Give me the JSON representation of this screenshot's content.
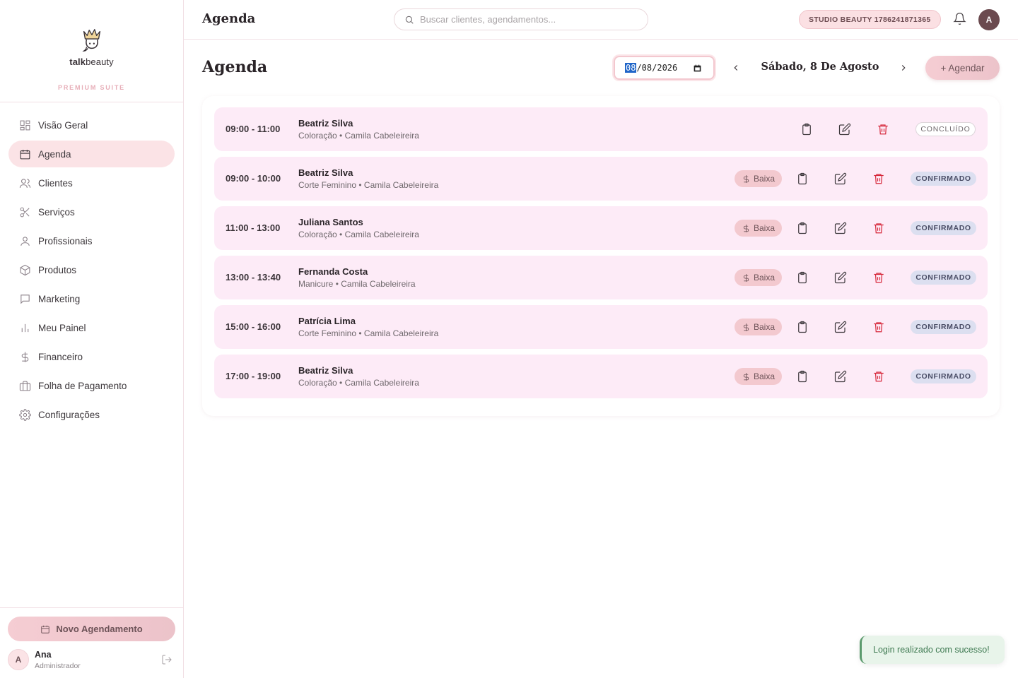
{
  "brand": {
    "name_bold": "talk",
    "name_regular": "beauty",
    "tagline": "PREMIUM SUITE"
  },
  "sidebar": {
    "items": [
      {
        "label": "Visão Geral",
        "icon": "grid-icon"
      },
      {
        "label": "Agenda",
        "icon": "calendar-icon",
        "active": true
      },
      {
        "label": "Clientes",
        "icon": "users-icon"
      },
      {
        "label": "Serviços",
        "icon": "scissors-icon"
      },
      {
        "label": "Profissionais",
        "icon": "user-icon"
      },
      {
        "label": "Produtos",
        "icon": "box-icon"
      },
      {
        "label": "Marketing",
        "icon": "message-icon"
      },
      {
        "label": "Meu Painel",
        "icon": "bar-chart-icon"
      },
      {
        "label": "Financeiro",
        "icon": "dollar-icon"
      },
      {
        "label": "Folha de Pagamento",
        "icon": "briefcase-icon"
      },
      {
        "label": "Configurações",
        "icon": "gear-icon"
      }
    ],
    "new_appointment_label": "Novo Agendamento",
    "user": {
      "initial": "A",
      "name": "Ana",
      "role": "Administrador"
    }
  },
  "topbar": {
    "title": "Agenda",
    "search_placeholder": "Buscar clientes, agendamentos...",
    "studio_badge": "STUDIO BEAUTY 1786241871365",
    "avatar_initial": "A"
  },
  "main": {
    "title": "Agenda",
    "date_input": {
      "day": "08",
      "rest": "/08/2026"
    },
    "date_label": "Sábado, 8 De Agosto",
    "add_button": "+ Agendar"
  },
  "appointments": [
    {
      "time": "09:00 - 11:00",
      "client": "Beatriz Silva",
      "detail": "Coloração • Camila Cabeleireira",
      "status": "CONCLUÍDO",
      "payment_label": ""
    },
    {
      "time": "09:00 - 10:00",
      "client": "Beatriz Silva",
      "detail": "Corte Feminino • Camila Cabeleireira",
      "status": "CONFIRMADO",
      "payment_label": "Baixa"
    },
    {
      "time": "11:00 - 13:00",
      "client": "Juliana Santos",
      "detail": "Coloração • Camila Cabeleireira",
      "status": "CONFIRMADO",
      "payment_label": "Baixa"
    },
    {
      "time": "13:00 - 13:40",
      "client": "Fernanda Costa",
      "detail": "Manicure • Camila Cabeleireira",
      "status": "CONFIRMADO",
      "payment_label": "Baixa"
    },
    {
      "time": "15:00 - 16:00",
      "client": "Patrícia Lima",
      "detail": "Corte Feminino • Camila Cabeleireira",
      "status": "CONFIRMADO",
      "payment_label": "Baixa"
    },
    {
      "time": "17:00 - 19:00",
      "client": "Beatriz Silva",
      "detail": "Coloração • Camila Cabeleireira",
      "status": "CONFIRMADO",
      "payment_label": "Baixa"
    }
  ],
  "toast": {
    "message": "Login realizado com sucesso!"
  },
  "colors": {
    "accent": "#f3c9cf",
    "active_nav": "#fbe3e6",
    "row_bg": "#fdebf7",
    "danger": "#d6273a",
    "confirmed_bg": "#dcdff0",
    "toast_text": "#3f7a52"
  }
}
